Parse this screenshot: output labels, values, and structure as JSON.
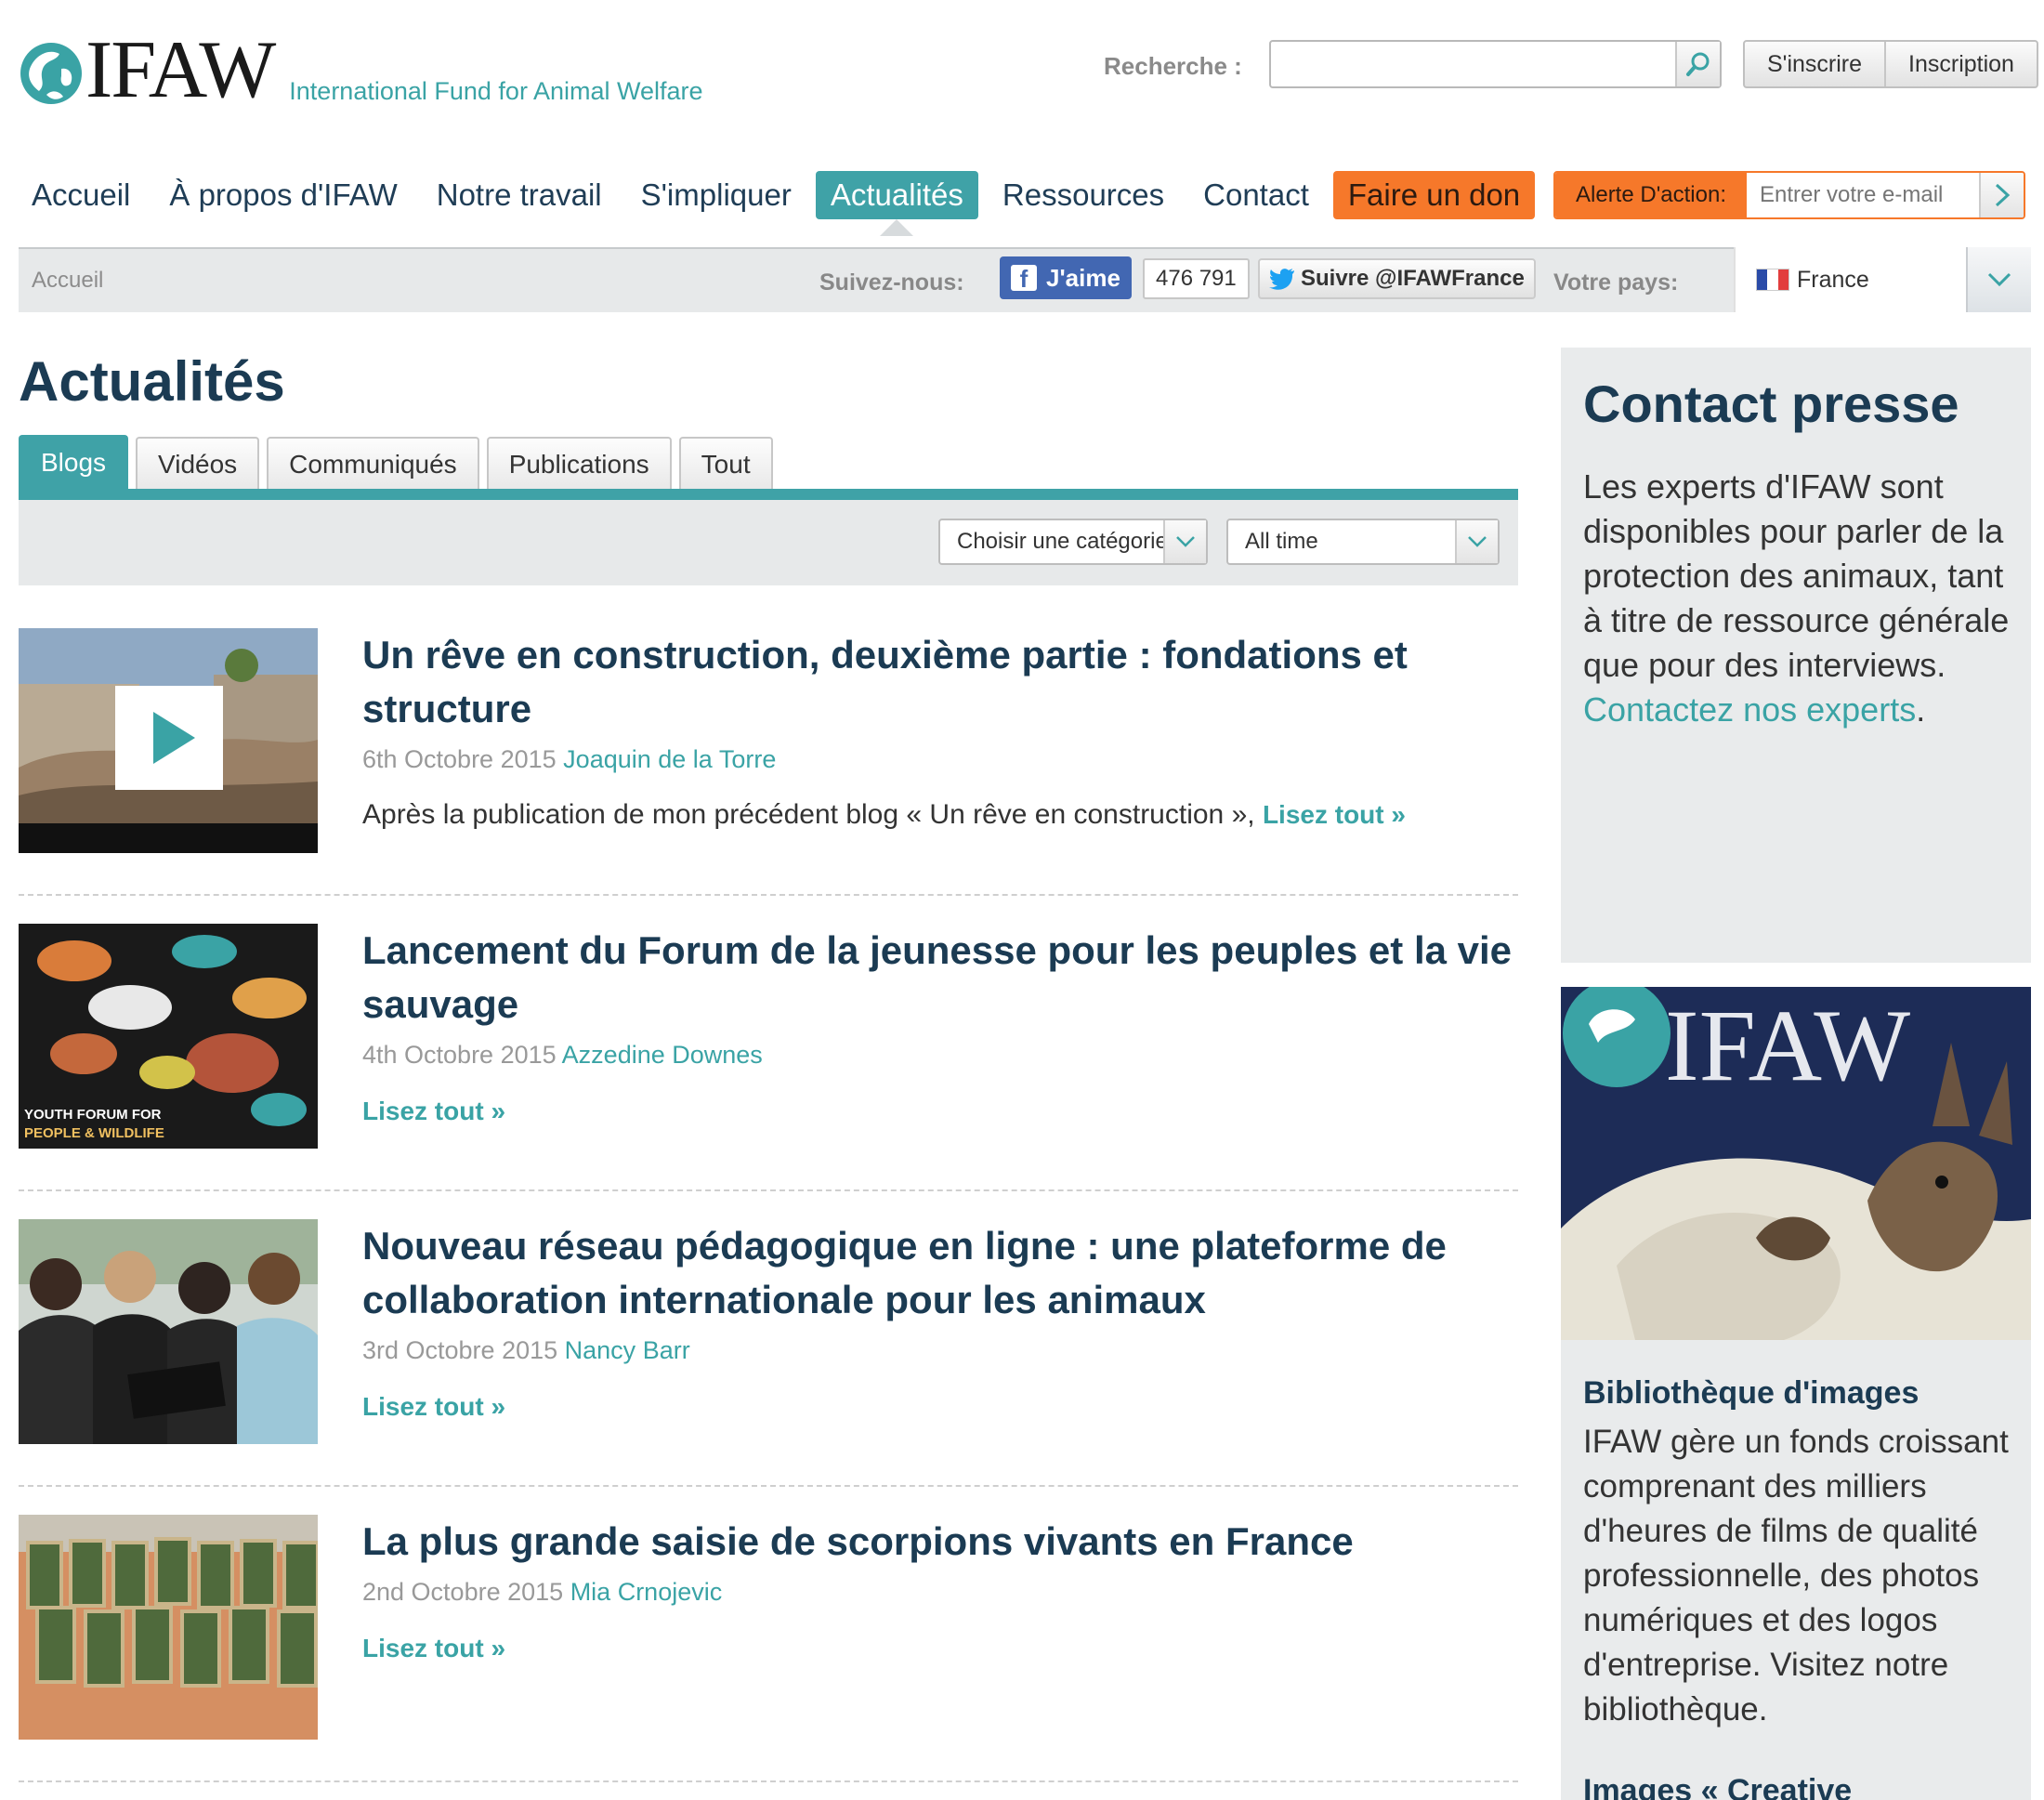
{
  "brand": {
    "logo_text": "IFAW",
    "tagline": "International Fund for Animal Welfare",
    "accent": "#3fa2a7",
    "donate_color": "#f6782a",
    "navy": "#1b3b53"
  },
  "header": {
    "search_label": "Recherche :",
    "search_value": "",
    "search_icon": "search-icon",
    "signin_label": "S'inscrire",
    "register_label": "Inscription"
  },
  "nav": {
    "items": [
      "Accueil",
      "À propos d'IFAW",
      "Notre travail",
      "S'impliquer",
      "Actualités",
      "Ressources",
      "Contact"
    ],
    "active_index": 4,
    "donate_label": "Faire un don",
    "alert_label": "Alerte D'action:",
    "alert_placeholder": "Entrer votre e-mail"
  },
  "subbar": {
    "breadcrumb": "Accueil",
    "follow_label": "Suivez-nous:",
    "fb_like_label": "J'aime",
    "fb_count": "476 791",
    "twitter_label": "Suivre @IFAWFrance",
    "country_label": "Votre pays:",
    "country_value": "France"
  },
  "main": {
    "title": "Actualités",
    "tabs": [
      "Blogs",
      "Vidéos",
      "Communiqués",
      "Publications",
      "Tout"
    ],
    "active_tab": 0,
    "filter_category": "Choisir une catégorie",
    "filter_time": "All time",
    "articles": [
      {
        "title": "Un rêve en construction, deuxième partie : fondations et structure",
        "date": "6th Octobre 2015",
        "author": "Joaquin de la Torre",
        "excerpt": "Après la publication de mon précédent blog « Un rêve en construction »,",
        "read_more": "Lisez tout »"
      },
      {
        "title": "Lancement du Forum de la jeunesse pour les peuples et la vie sauvage",
        "date": "4th Octobre 2015",
        "author": "Azzedine Downes",
        "excerpt": "",
        "read_more": "Lisez tout »"
      },
      {
        "title": "Nouveau réseau pédagogique en ligne : une plateforme de collaboration internationale pour les animaux",
        "date": "3rd Octobre 2015",
        "author": "Nancy Barr",
        "excerpt": "",
        "read_more": "Lisez tout »"
      },
      {
        "title": "La plus grande saisie de scorpions vivants en France",
        "date": "2nd Octobre 2015",
        "author": "Mia Crnojevic",
        "excerpt": "",
        "read_more": "Lisez tout »"
      }
    ]
  },
  "sidebar": {
    "contact_title": "Contact presse",
    "contact_text": "Les experts d'IFAW sont disponibles pour parler de la protection des animaux, tant à titre de ressource générale que pour des interviews.",
    "contact_link": "Contactez nos experts",
    "contact_end": ".",
    "library_title": "Bibliothèque d'images",
    "library_text": "IFAW gère un fonds croissant comprenant des milliers d'heures de films de qualité professionnelle, des photos numériques et des logos d'entreprise. Visitez notre bibliothèque.",
    "cc_title": "Images « Creative"
  }
}
